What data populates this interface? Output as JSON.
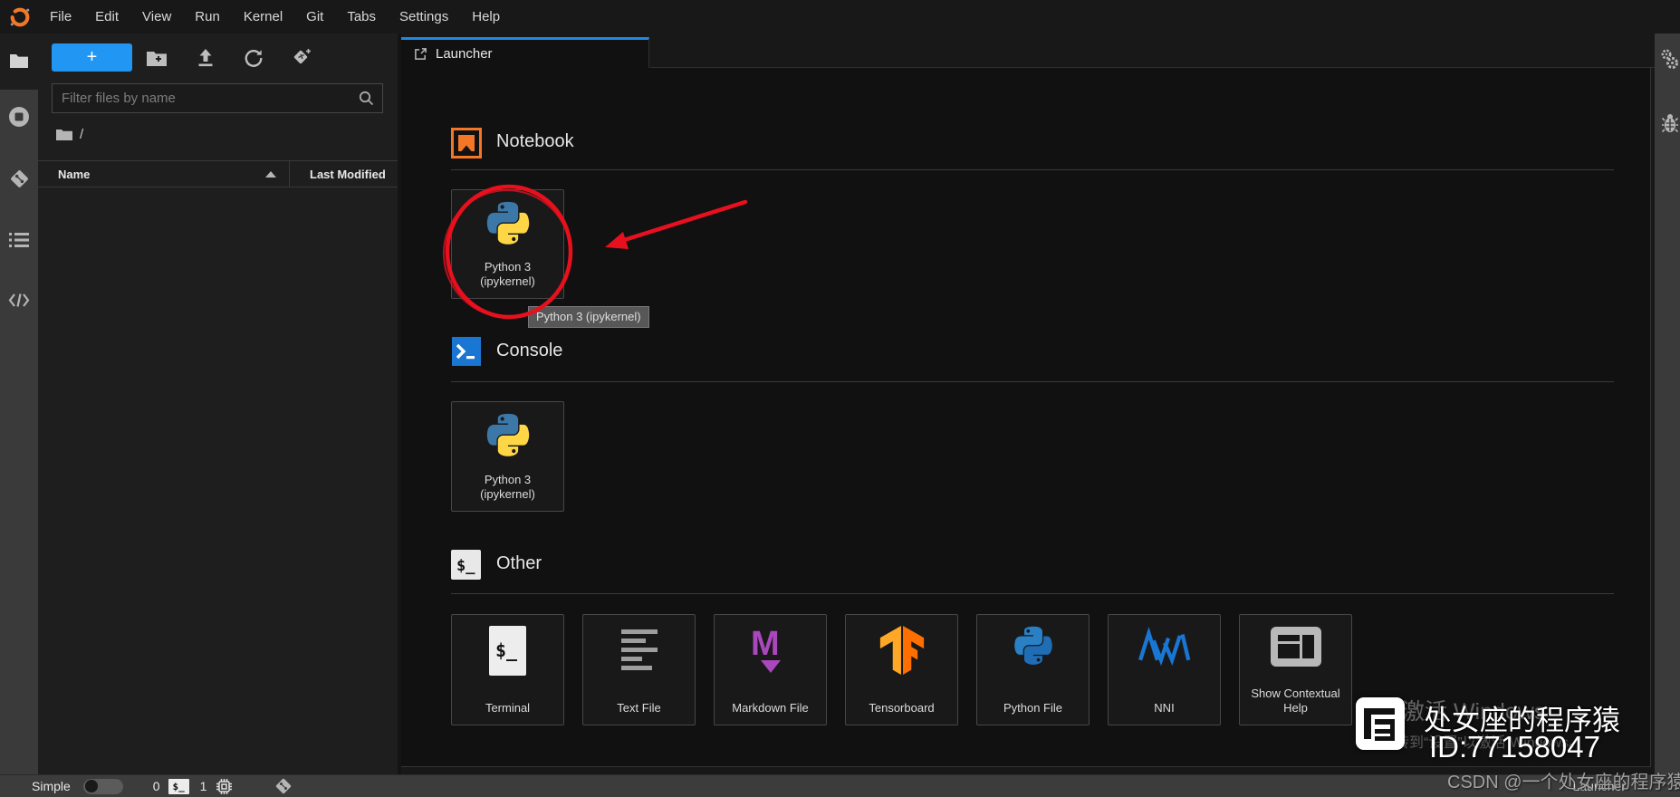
{
  "menu": {
    "items": [
      "File",
      "Edit",
      "View",
      "Run",
      "Kernel",
      "Git",
      "Tabs",
      "Settings",
      "Help"
    ]
  },
  "file_browser": {
    "filter_placeholder": "Filter files by name",
    "breadcrumb_path": "/",
    "columns": {
      "name": "Name",
      "last_modified": "Last Modified"
    }
  },
  "tab_bar": {
    "launcher_label": "Launcher"
  },
  "launcher": {
    "sections": [
      {
        "title": "Notebook",
        "cards": [
          {
            "label": "Python 3 (ipykernel)"
          }
        ]
      },
      {
        "title": "Console",
        "cards": [
          {
            "label": "Python 3 (ipykernel)"
          }
        ]
      },
      {
        "title": "Other",
        "cards": [
          {
            "label": "Terminal"
          },
          {
            "label": "Text File"
          },
          {
            "label": "Markdown File"
          },
          {
            "label": "Tensorboard"
          },
          {
            "label": "Python File"
          },
          {
            "label": "NNI"
          },
          {
            "label": "Show Contextual Help"
          }
        ]
      }
    ],
    "tooltip": "Python 3 (ipykernel)"
  },
  "status_bar": {
    "simple_label": "Simple",
    "terminal_count": "0",
    "kernel_count": "1",
    "context": "Launcher"
  },
  "watermark": {
    "title": "处女座的程序猿",
    "id_line": "ID:77158047",
    "csdn_line": "CSDN @一个处女座的程序猿",
    "windows_line1": "激活 Windows",
    "windows_line2": "转到“设置”以激活 Windows。"
  },
  "icons": {
    "jupyter-logo": "orange broken circle",
    "folder-icon": "folder",
    "running-icon": "stop circle",
    "git-icon": "git diamond",
    "toc-icon": "bulleted list",
    "extensions-icon": "code brackets",
    "new-launcher-button": "+",
    "new-folder-icon": "folder+",
    "upload-icon": "arrow up",
    "refresh-icon": "circular arrow",
    "tag-plus-icon": "diamond tag+",
    "search-icon": "magnifier",
    "launcher-tab-icon": "box with NE arrow",
    "notebook-icon": "orange notebook",
    "console-icon": "blue >_",
    "terminal-icon": "$_",
    "text-file-icon": "text lines",
    "markdown-icon": "purple M arrow",
    "tensorboard-icon": "TF logo",
    "python-icon": "python logo",
    "nni-icon": "blue zigzag",
    "contextual-help-icon": "split panel",
    "gears-icon": "double gear",
    "bug-icon": "bug",
    "kernel-chip-icon": "cpu chip",
    "csdn-logo": "white square glyph",
    "red-circle-annotation": "ellipse",
    "red-arrow-annotation": "arrow"
  },
  "colors": {
    "accent": "#2196F3",
    "tab_accent": "#1E88E5",
    "annotation_red": "#E8101E",
    "jupyter_orange": "#F37726",
    "console_blue": "#1976D2",
    "markdown_purple": "#AB47BC",
    "tensorflow_orange": "#FF6F00",
    "nni_blue": "#1976D2",
    "python_blue": "#3B78A8",
    "python_yellow": "#FFD645"
  }
}
